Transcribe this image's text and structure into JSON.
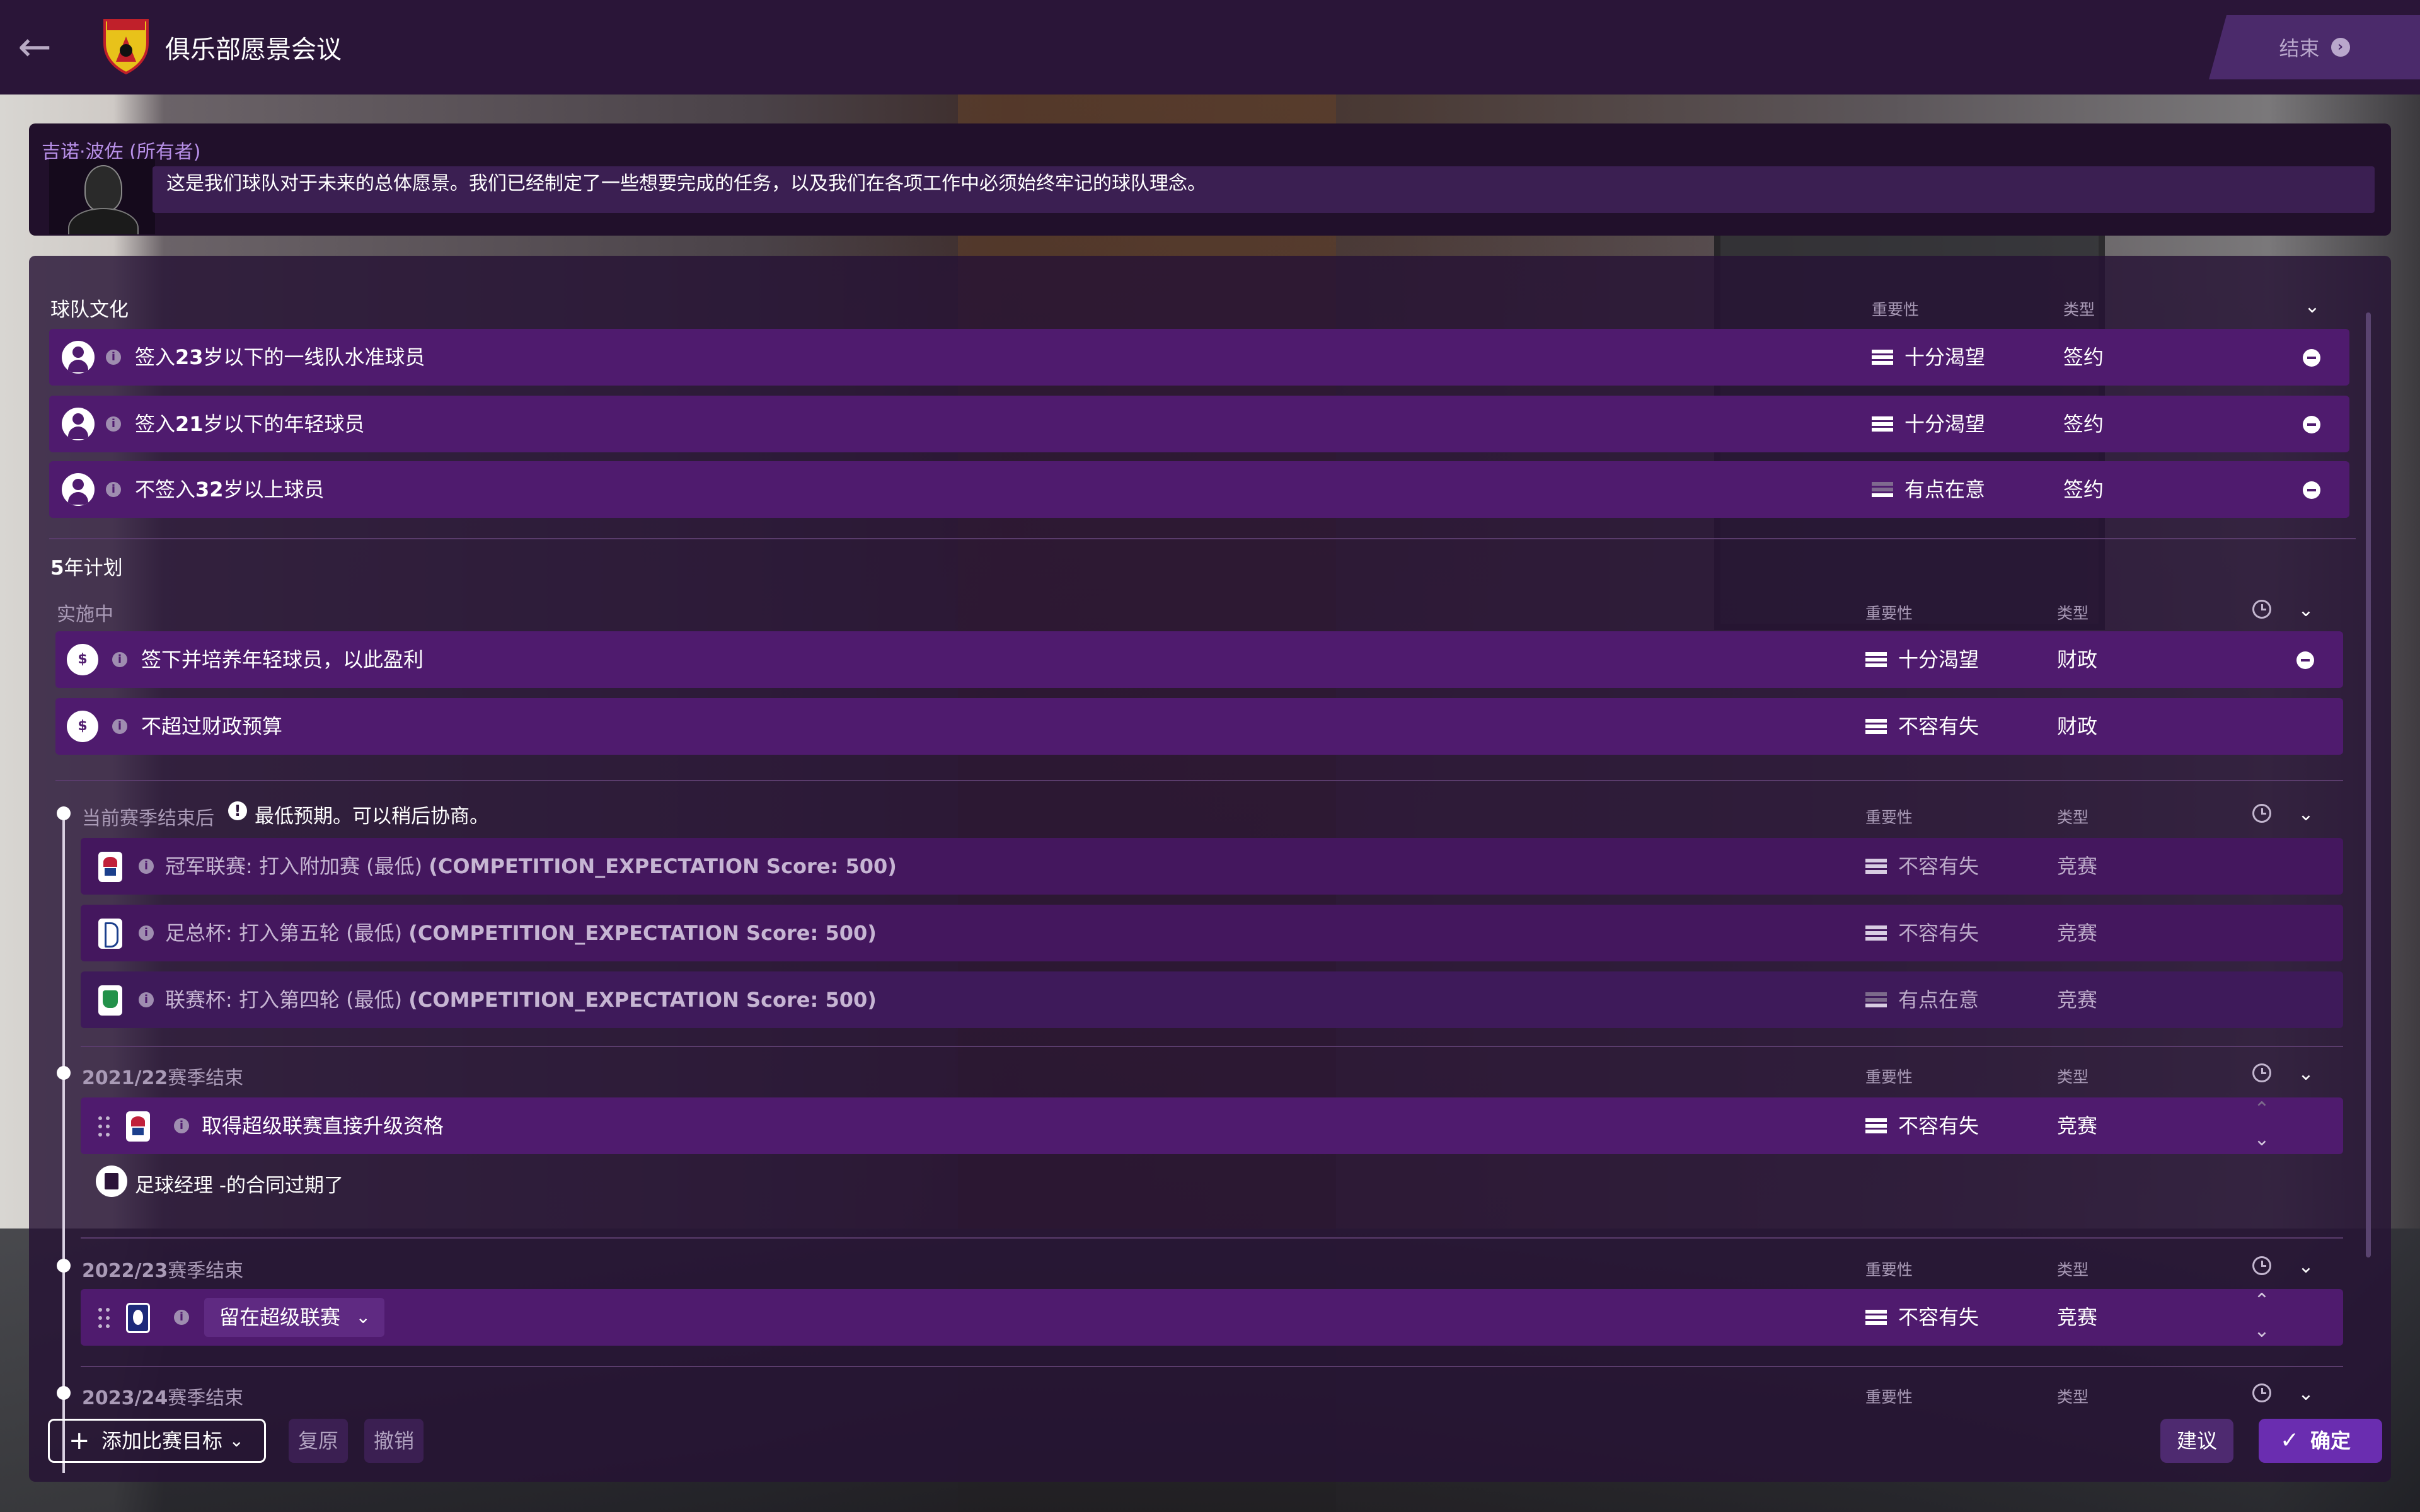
{
  "header": {
    "title": "俱乐部愿景会议",
    "end_label": "结束"
  },
  "message": {
    "speaker": "吉诺·波佐",
    "speaker_role": "(所有者)",
    "text": "这是我们球队对于未来的总体愿景。我们已经制定了一些想要完成的任务，以及我们在各项工作中必须始终牢记的球队理念。"
  },
  "columns": {
    "importance": "重要性",
    "type": "类型"
  },
  "culture": {
    "title": "球队文化",
    "items": [
      {
        "pre": "签入",
        "num": "23",
        "post": "岁以下的一线队水准球员",
        "importance": "十分渴望",
        "type": "签约"
      },
      {
        "pre": "签入",
        "num": "21",
        "post": "岁以下的年轻球员",
        "importance": "十分渴望",
        "type": "签约"
      },
      {
        "pre": "不签入",
        "num": "32",
        "post": "岁以上球员",
        "importance": "有点在意",
        "type": "签约"
      }
    ]
  },
  "plan": {
    "title_num": "5",
    "title_text": "年计划",
    "in_progress_label": "实施中",
    "in_progress": [
      {
        "text": "签下并培养年轻球员，以此盈利",
        "importance": "十分渴望",
        "type": "财政"
      },
      {
        "text": "不超过财政预算",
        "importance": "不容有失",
        "type": "财政"
      }
    ],
    "current_season": {
      "label": "当前赛季结束后",
      "note": "最低预期。可以稍后协商。",
      "items": [
        {
          "text": "冠军联赛: 打入附加赛 (最低)",
          "code": "(COMPETITION_EXPECTATION Score: 500)",
          "importance": "不容有失",
          "type": "竞赛"
        },
        {
          "text": "足总杯: 打入第五轮 (最低)",
          "code": "(COMPETITION_EXPECTATION Score: 500)",
          "importance": "不容有失",
          "type": "竞赛"
        },
        {
          "text": "联赛杯: 打入第四轮 (最低)",
          "code": "(COMPETITION_EXPECTATION Score: 500)",
          "importance": "有点在意",
          "type": "竞赛"
        }
      ]
    },
    "season_2122": {
      "label_num": "2021/22",
      "label_text": "赛季结束",
      "goal": {
        "text": "取得超级联赛直接升级资格",
        "importance": "不容有失",
        "type": "竞赛"
      },
      "contract_note": "足球经理 -的合同过期了"
    },
    "season_2223": {
      "label_num": "2022/23",
      "label_text": "赛季结束",
      "goal": {
        "text": "留在超级联赛",
        "importance": "不容有失",
        "type": "竞赛"
      }
    },
    "season_2324": {
      "label_num": "2023/24",
      "label_text": "赛季结束"
    }
  },
  "footer": {
    "add_goal": "添加比赛目标",
    "restore": "复原",
    "undo": "撤销",
    "suggest": "建议",
    "confirm": "确定"
  }
}
